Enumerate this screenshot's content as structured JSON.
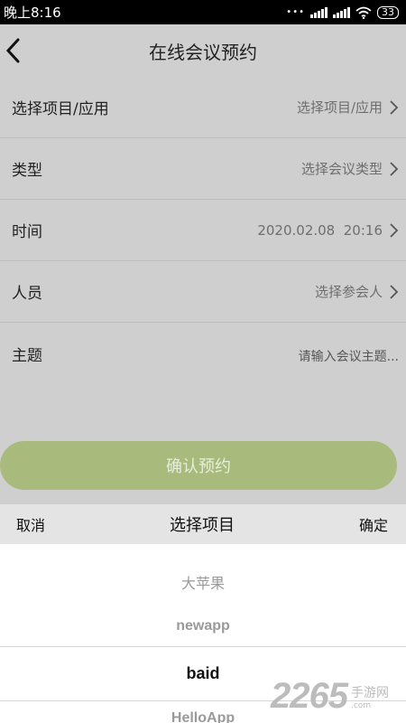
{
  "status_bar": {
    "time": "晚上8:16",
    "dots": "•••",
    "battery": "33"
  },
  "header": {
    "title": "在线会议预约"
  },
  "form": {
    "project": {
      "label": "选择项目/应用",
      "value": "选择项目/应用"
    },
    "type": {
      "label": "类型",
      "value": "选择会议类型"
    },
    "time": {
      "label": "时间",
      "value": "2020.02.08  20:16"
    },
    "people": {
      "label": "人员",
      "value": "选择参会人"
    },
    "topic": {
      "label": "主题",
      "placeholder": "请输入会议主题..."
    }
  },
  "confirm_button": {
    "label": "确认预约"
  },
  "picker": {
    "cancel": "取消",
    "title": "选择项目",
    "confirm": "确定",
    "items": [
      "大苹果",
      "newapp",
      "baid",
      "HelloApp"
    ],
    "selected": "baid"
  },
  "watermark": {
    "digits": "2265",
    "cn": "手游网",
    "en": ".com"
  },
  "colors": {
    "overlay_bg": "#cfcfcf",
    "confirm_button": "#a9bb7c",
    "picker_toolbar": "#e4e4e4"
  }
}
